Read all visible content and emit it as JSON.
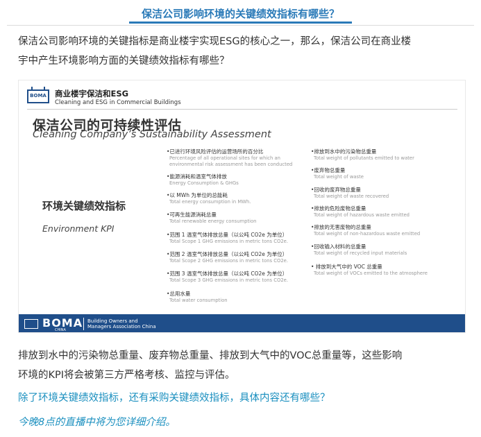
{
  "article": {
    "title": "保洁公司影响环境的关键绩效指标有哪些？",
    "intro_line1": "保洁公司影响环境的关键指标是商业楼宇实现ESG的核心之一，那么，保洁公司在商业楼",
    "intro_line2": "宇中产生环境影响方面的关键绩效指标有哪些？",
    "summary_line1": "排放到水中的污染物总重量、废弃物总重量、排放到大气中的VOC总重量等，这些影响",
    "summary_line2": "环境的KPI将会被第三方严格考核、监控与评估。",
    "question": "除了环境关键绩效指标，还有采购关键绩效指标，具体内容还有哪些？",
    "tonight": "今晚8点的直播中将为您详细介绍。"
  },
  "slide": {
    "logo": "BOMA",
    "header_cn": "商业楼宇保洁和ESG",
    "header_en": "Cleaning and ESG in Commercial Buildings",
    "sustain_cn": "保洁公司的可持续性评估",
    "sustain_en": "Cleaning Company’s Sustainability Assessment",
    "kpi_cn": "环境关键绩效指标",
    "kpi_en": "Environment KPI",
    "left_items": [
      {
        "cn": "•已进行环境风险评估的运营场所的百分比",
        "en1": "Percentage of all operational sites for which an",
        "en2": "environmental risk assessment has been conducted"
      },
      {
        "cn": "•能源消耗和温室气体排放",
        "en1": "Energy Consumption & GHGs"
      },
      {
        "cn": "•以 MWh 为单位的总能耗",
        "en1": "Total energy consumption in MWh."
      },
      {
        "cn": "•可再生能源消耗总量",
        "en1": "Total renewable energy consumption"
      },
      {
        "cn": "•范围 1 温室气体排放总量（以公吨 CO2e 为单位）",
        "en1": "Total Scope 1 GHG emissions in metric tons CO2e."
      },
      {
        "cn": "•范围 2 温室气体排放总量（以公吨 CO2e 为单位）",
        "en1": "Total Scope 2 GHG emissions in metric tons CO2e."
      },
      {
        "cn": "•范围 3 温室气体排放总量（以公吨 CO2e 为单位）",
        "en1": "Total Scope 3 GHG emissions in metric tons CO2e."
      },
      {
        "cn": "•总用水量",
        "en1": "Total water consumption"
      }
    ],
    "right_items": [
      {
        "cn": "•排放到水中的污染物总重量",
        "en1": "Total weight of pollutants emitted to water"
      },
      {
        "cn": "•废弃物总重量",
        "en1": "Total weight of waste"
      },
      {
        "cn": "•回收的废弃物总重量",
        "en1": "Total weight of waste recovered"
      },
      {
        "cn": "•排放的危险废物总重量",
        "en1": "Total weight of hazardous waste emitted"
      },
      {
        "cn": "•排放的无害废物的总重量",
        "en1": "Total weight of non-hazardous waste emitted"
      },
      {
        "cn": "•回收输入材料的总重量",
        "en1": "Total weight of recycled input materials"
      },
      {
        "cn": "• 排放到大气中的 VOC 总重量",
        "en1": "Total weight of VOCs emitted to the atmosphere"
      }
    ],
    "footer_logo": "BOMA",
    "footer_china": "CHINA",
    "footer_org_line1": "Building Owners and",
    "footer_org_line2": "Managers Association China"
  },
  "colors": {
    "accent": "#2a7ab8",
    "link": "#1a8fbf",
    "boma_blue": "#1f4e8a"
  }
}
